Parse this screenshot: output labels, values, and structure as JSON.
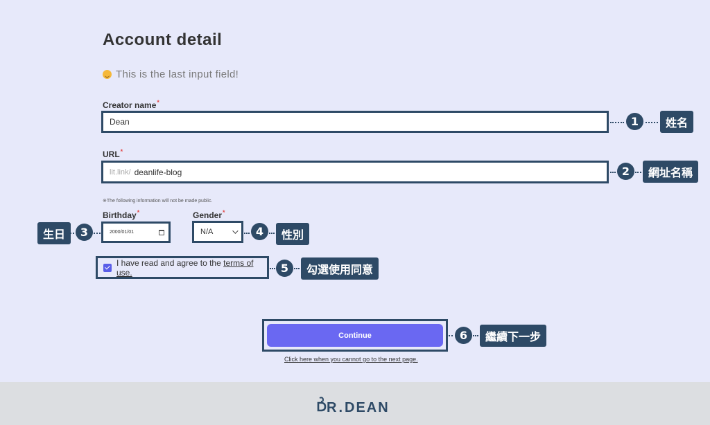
{
  "form": {
    "title": "Account detail",
    "subtitle": "This is the last input field!",
    "creator_name": {
      "label": "Creator name",
      "required": "*",
      "value": "Dean"
    },
    "url": {
      "label": "URL",
      "required": "*",
      "prefix": "lit.link/",
      "value": "deanlife-blog"
    },
    "privacy_note": "※The following information will not be made public.",
    "birthday": {
      "label": "Birthday",
      "required": "*",
      "value": "2000/01/01"
    },
    "gender": {
      "label": "Gender",
      "required": "*",
      "value": "N/A"
    },
    "agree": {
      "text": "I have read and agree to the",
      "link": "terms of use.",
      "checked": true
    },
    "continue_label": "Continue",
    "help_link": "Click here when you cannot go to the next page."
  },
  "annotations": [
    {
      "number": "1",
      "text": "姓名"
    },
    {
      "number": "2",
      "text": "網址名稱"
    },
    {
      "number": "3",
      "text": "生日"
    },
    {
      "number": "4",
      "text": "性別"
    },
    {
      "number": "5",
      "text": "勾選使用同意"
    },
    {
      "number": "6",
      "text": "繼續下一步"
    }
  ],
  "footer": {
    "brand_left": "R",
    "brand_right": "DEAN",
    "brand_dot": "."
  },
  "colors": {
    "background": "#e7e9fa",
    "annotation": "#2e4a66",
    "button": "#6a68f2",
    "required": "#e24a4a"
  }
}
